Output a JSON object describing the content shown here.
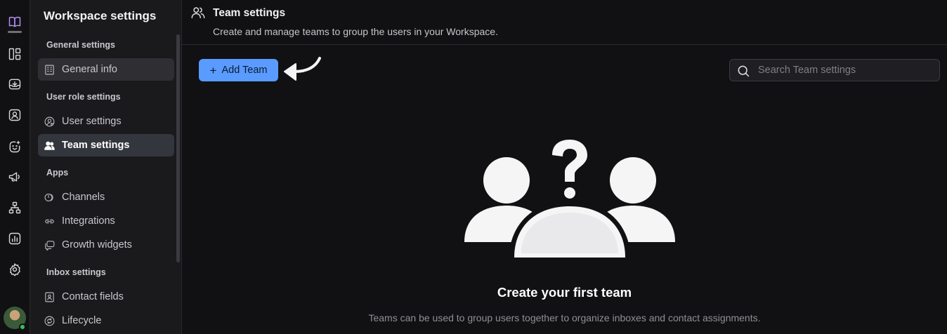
{
  "rail": {
    "icons": [
      "book-open-icon",
      "board-icon",
      "inbox-icon",
      "contacts-icon",
      "ai-face-icon",
      "megaphone-icon",
      "workflow-icon",
      "reports-icon",
      "gear-icon"
    ]
  },
  "sidebar": {
    "title": "Workspace settings",
    "sections": [
      {
        "label": "General settings"
      },
      {
        "label": "User role settings"
      },
      {
        "label": "Apps"
      },
      {
        "label": "Inbox settings"
      }
    ],
    "items": [
      {
        "label": "General info",
        "icon": "building-icon",
        "state": "hover"
      },
      {
        "label": "User settings",
        "icon": "user-gear-icon"
      },
      {
        "label": "Team settings",
        "icon": "team-icon",
        "state": "selected"
      },
      {
        "label": "Channels",
        "icon": "channels-icon"
      },
      {
        "label": "Integrations",
        "icon": "link-icon"
      },
      {
        "label": "Growth widgets",
        "icon": "chat-widget-icon"
      },
      {
        "label": "Contact fields",
        "icon": "contact-card-icon"
      },
      {
        "label": "Lifecycle",
        "icon": "refresh-icon"
      }
    ]
  },
  "header": {
    "title": "Team settings",
    "subtitle": "Create and manage teams to group the users in your Workspace."
  },
  "toolbar": {
    "add_label": "Add Team",
    "search_placeholder": "Search Team settings"
  },
  "empty_state": {
    "title": "Create your first team",
    "description": "Teams can be used to group users together to organize inboxes and contact assignments."
  },
  "colors": {
    "accent": "#5a9bff",
    "active_rail": "#b892ff",
    "status_online": "#32c45a"
  }
}
